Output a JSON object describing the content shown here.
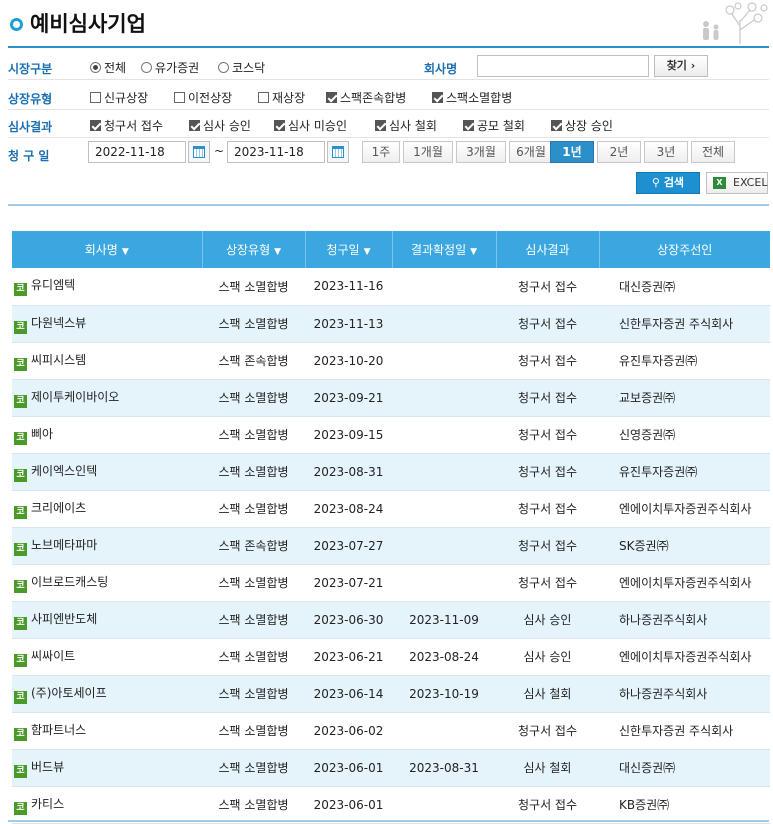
{
  "page": {
    "title": "예비심사기업"
  },
  "filters": {
    "market": {
      "label": "시장구분",
      "options": [
        {
          "label": "전체",
          "selected": true
        },
        {
          "label": "유가증권",
          "selected": false
        },
        {
          "label": "코스닥",
          "selected": false
        }
      ]
    },
    "company_name": {
      "label": "회사명",
      "value": "",
      "placeholder": "",
      "find_button": "찾기 ›"
    },
    "listing_type": {
      "label": "상장유형",
      "options": [
        {
          "label": "신규상장",
          "checked": false
        },
        {
          "label": "이전상장",
          "checked": false
        },
        {
          "label": "재상장",
          "checked": false
        },
        {
          "label": "스팩존속합병",
          "checked": true
        },
        {
          "label": "스팩소멸합병",
          "checked": true
        }
      ]
    },
    "review_result": {
      "label": "심사결과",
      "options": [
        {
          "label": "청구서 접수",
          "checked": true
        },
        {
          "label": "심사 승인",
          "checked": true
        },
        {
          "label": "심사 미승인",
          "checked": true
        },
        {
          "label": "심사 철회",
          "checked": true
        },
        {
          "label": "공모 철회",
          "checked": true
        },
        {
          "label": "상장 승인",
          "checked": true
        }
      ]
    },
    "request_date": {
      "label": "청 구 일",
      "from": "2022-11-18",
      "separator": "~",
      "to": "2023-11-18",
      "periods": [
        {
          "label": "1주",
          "active": false
        },
        {
          "label": "1개월",
          "active": false
        },
        {
          "label": "3개월",
          "active": false
        },
        {
          "label": "6개월",
          "active": false
        },
        {
          "label": "1년",
          "active": true
        },
        {
          "label": "2년",
          "active": false
        },
        {
          "label": "3년",
          "active": false
        },
        {
          "label": "전체",
          "active": false
        }
      ]
    },
    "search_button": "검색",
    "excel_button": "EXCEL"
  },
  "table": {
    "columns": [
      {
        "label": "회사명",
        "sortable": true
      },
      {
        "label": "상장유형",
        "sortable": true
      },
      {
        "label": "청구일",
        "sortable": true
      },
      {
        "label": "결과확정일",
        "sortable": true
      },
      {
        "label": "심사결과",
        "sortable": false
      },
      {
        "label": "상장주선인",
        "sortable": false
      }
    ],
    "market_icon_label": "코",
    "rows": [
      {
        "name": "유디엠텍",
        "type": "스팩 소멸합병",
        "date": "2023-11-16",
        "decided": "",
        "result": "청구서 접수",
        "underwriter": "대신증권㈜"
      },
      {
        "name": "다원넥스뷰",
        "type": "스팩 소멸합병",
        "date": "2023-11-13",
        "decided": "",
        "result": "청구서 접수",
        "underwriter": "신한투자증권 주식회사"
      },
      {
        "name": "씨피시스템",
        "type": "스팩 존속합병",
        "date": "2023-10-20",
        "decided": "",
        "result": "청구서 접수",
        "underwriter": "유진투자증권㈜"
      },
      {
        "name": "제이투케이바이오",
        "type": "스팩 소멸합병",
        "date": "2023-09-21",
        "decided": "",
        "result": "청구서 접수",
        "underwriter": "교보증권㈜"
      },
      {
        "name": "삐아",
        "type": "스팩 소멸합병",
        "date": "2023-09-15",
        "decided": "",
        "result": "청구서 접수",
        "underwriter": "신영증권㈜"
      },
      {
        "name": "케이엑스인텍",
        "type": "스팩 소멸합병",
        "date": "2023-08-31",
        "decided": "",
        "result": "청구서 접수",
        "underwriter": "유진투자증권㈜"
      },
      {
        "name": "크리에이츠",
        "type": "스팩 소멸합병",
        "date": "2023-08-24",
        "decided": "",
        "result": "청구서 접수",
        "underwriter": "엔에이치투자증권주식회사"
      },
      {
        "name": "노브메타파마",
        "type": "스팩 존속합병",
        "date": "2023-07-27",
        "decided": "",
        "result": "청구서 접수",
        "underwriter": "SK증권㈜"
      },
      {
        "name": "이브로드캐스팅",
        "type": "스팩 소멸합병",
        "date": "2023-07-21",
        "decided": "",
        "result": "청구서 접수",
        "underwriter": "엔에이치투자증권주식회사"
      },
      {
        "name": "사피엔반도체",
        "type": "스팩 소멸합병",
        "date": "2023-06-30",
        "decided": "2023-11-09",
        "result": "심사 승인",
        "underwriter": "하나증권주식회사"
      },
      {
        "name": "씨싸이트",
        "type": "스팩 소멸합병",
        "date": "2023-06-21",
        "decided": "2023-08-24",
        "result": "심사 승인",
        "underwriter": "엔에이치투자증권주식회사"
      },
      {
        "name": "(주)아토세이프",
        "type": "스팩 소멸합병",
        "date": "2023-06-14",
        "decided": "2023-10-19",
        "result": "심사 철회",
        "underwriter": "하나증권주식회사"
      },
      {
        "name": "함파트너스",
        "type": "스팩 소멸합병",
        "date": "2023-06-02",
        "decided": "",
        "result": "청구서 접수",
        "underwriter": "신한투자증권 주식회사"
      },
      {
        "name": "버드뷰",
        "type": "스팩 소멸합병",
        "date": "2023-06-01",
        "decided": "2023-08-31",
        "result": "심사 철회",
        "underwriter": "대신증권㈜"
      },
      {
        "name": "카티스",
        "type": "스팩 소멸합병",
        "date": "2023-06-01",
        "decided": "",
        "result": "청구서 접수",
        "underwriter": "KB증권㈜"
      }
    ]
  },
  "colors": {
    "accent": "#1aa0d6",
    "header_bg": "#3aa7e0",
    "row_alt": "#e5f4fb",
    "label": "#1a6fb0"
  }
}
